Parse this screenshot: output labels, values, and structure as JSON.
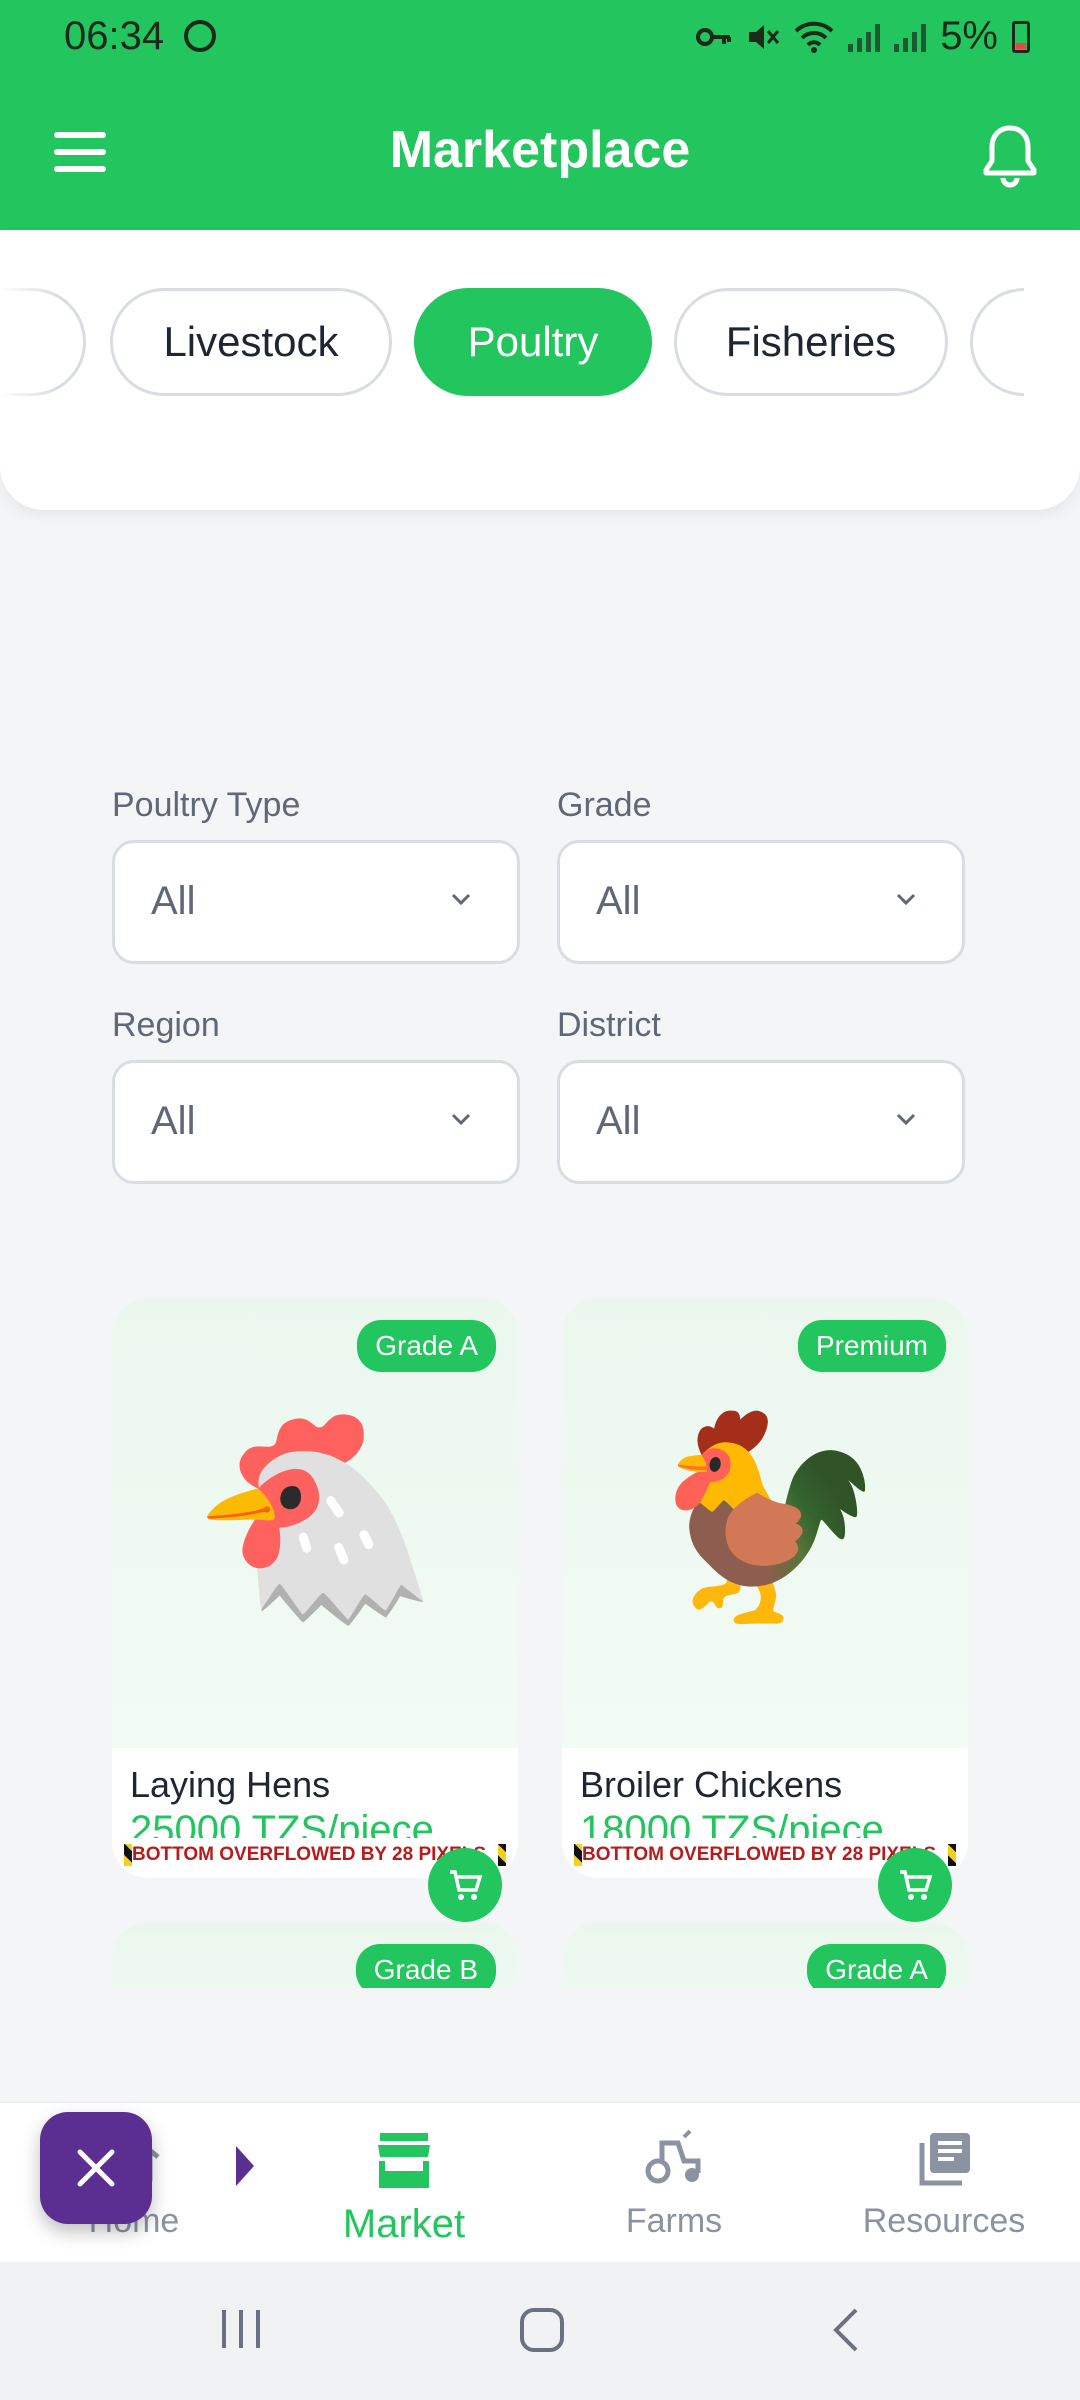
{
  "status_bar": {
    "time": "06:34",
    "battery": "5%"
  },
  "app_bar": {
    "title": "Marketplace",
    "menu_icon": "menu-icon",
    "notification_icon": "bell-icon"
  },
  "categories": [
    {
      "label": "Livestock"
    },
    {
      "label": "Poultry",
      "selected": true
    },
    {
      "label": "Fisheries"
    }
  ],
  "filters": {
    "poultry_type": {
      "label": "Poultry Type",
      "value": "All"
    },
    "grade": {
      "label": "Grade",
      "value": "All"
    },
    "region": {
      "label": "Region",
      "value": "All"
    },
    "district": {
      "label": "District",
      "value": "All"
    }
  },
  "products": [
    {
      "name": "Laying Hens",
      "price": "25000 TZS/piece",
      "badge": "Grade A",
      "emoji": "🐔",
      "overflow_text": "BOTTOM OVERFLOWED BY 28 PIXELS"
    },
    {
      "name": "Broiler Chickens",
      "price": "18000 TZS/piece",
      "badge": "Premium",
      "emoji": "🐓",
      "overflow_text": "BOTTOM OVERFLOWED BY 28 PIXELS"
    },
    {
      "badge": "Grade B"
    },
    {
      "badge": "Grade A"
    }
  ],
  "bottom_nav": [
    {
      "label": "Home",
      "icon": "home-icon"
    },
    {
      "label": "Market",
      "icon": "store-icon",
      "active": true
    },
    {
      "label": "Farms",
      "icon": "tractor-icon"
    },
    {
      "label": "Resources",
      "icon": "library-icon"
    }
  ],
  "colors": {
    "primary": "#22c55e",
    "fab": "#5b2e91",
    "error_text": "#b71c1c"
  }
}
